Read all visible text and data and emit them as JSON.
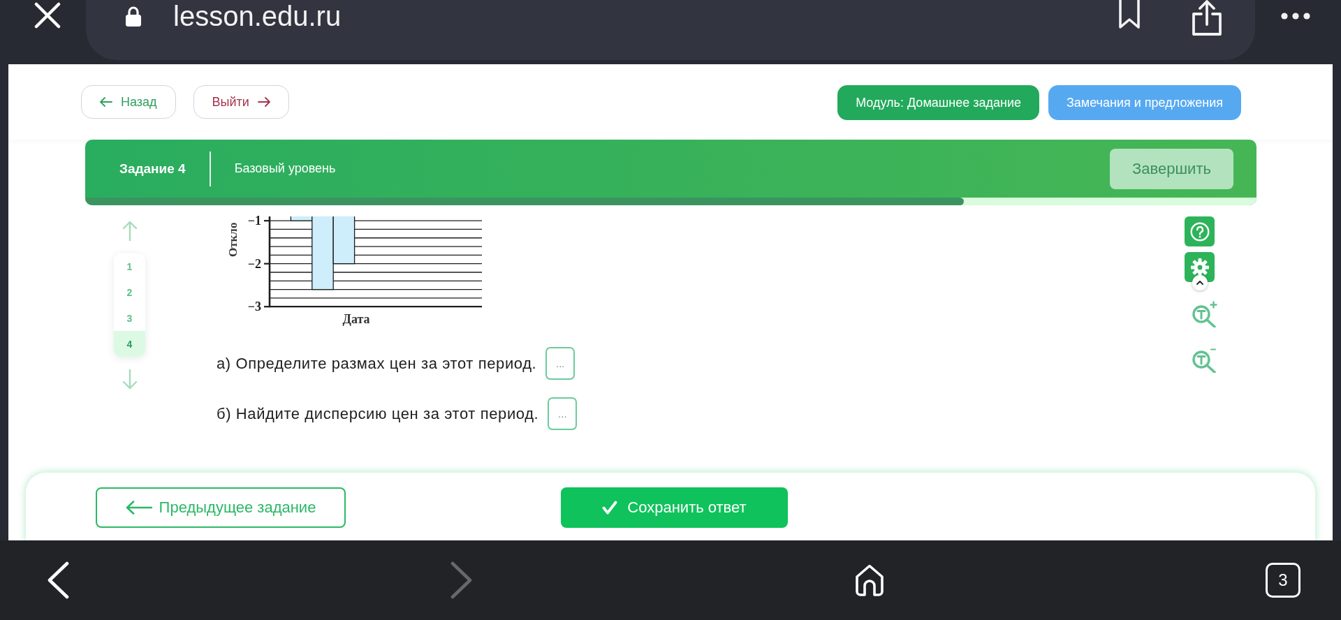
{
  "browser": {
    "url": "lesson.edu.ru",
    "forward_disabled": true,
    "tab_count": "3"
  },
  "header": {
    "back_button": "Назад",
    "exit_button": "Выйти",
    "module_button": "Модуль: Домашнее задание",
    "feedback_button": "Замечания и предложения"
  },
  "task_bar": {
    "title": "Задание 4",
    "difficulty": "Базовый уровень",
    "finish_button": {
      "label": "Завершить",
      "disabled": true
    },
    "progress": {
      "level": 0.75
    }
  },
  "task_nav": {
    "items": [
      {
        "label": "1",
        "selected": false
      },
      {
        "label": "2",
        "selected": false
      },
      {
        "label": "3",
        "selected": false
      },
      {
        "label": "4",
        "selected": true
      }
    ]
  },
  "figure": {
    "chart_data": {
      "type": "bar",
      "xlabel": "Дата",
      "ylabel": "Откло",
      "values": [
        null,
        -1,
        -2.6,
        -2,
        null,
        null,
        null,
        null,
        null,
        null
      ],
      "ylim": [
        -3,
        -0.9
      ],
      "yticks": [
        {
          "value": -1,
          "label": "−1"
        },
        {
          "value": -2,
          "label": "−2"
        },
        {
          "value": -3,
          "label": "−3"
        }
      ]
    }
  },
  "questions": [
    {
      "text": "а) Определите размах цен за этот период.",
      "placeholder": "..."
    },
    {
      "text": "б) Найдите дисперсию цен за этот период.",
      "placeholder": "..."
    }
  ],
  "footer": {
    "previous_button": "Предыдущее задание",
    "save_button": "Сохранить ответ"
  }
}
